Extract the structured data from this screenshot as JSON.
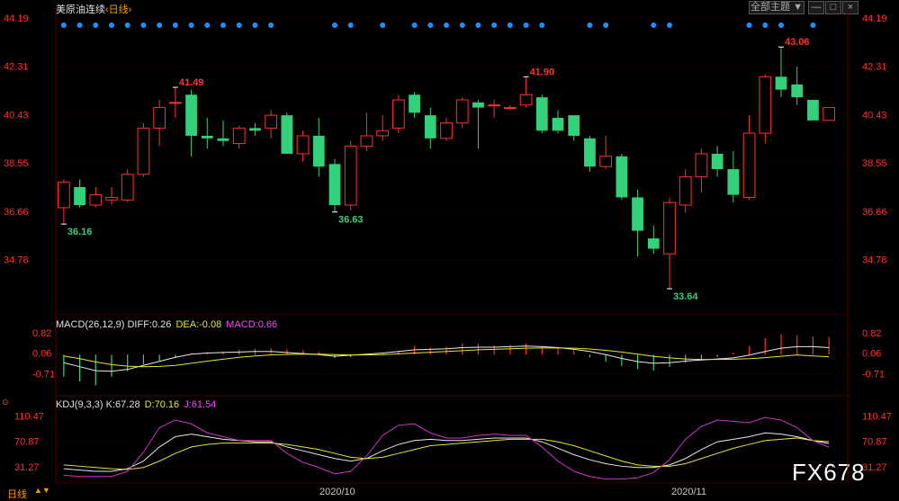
{
  "header": {
    "title": "美原油连续",
    "period": "‹日线›",
    "theme_button": "全部主题 ▼"
  },
  "colors": {
    "up": "#ff3030",
    "down": "#33d17a",
    "macd_diff": "#e8e8e8",
    "macd_dea": "#e6e62a",
    "macd_label": "#ff40ff",
    "kdj_k": "#e8e8e8",
    "kdj_d": "#e6e62a",
    "kdj_j": "#cc33cc",
    "axis_price": "#ff3030",
    "event_dot": "#1e90ff"
  },
  "icons": [
    "minimize-icon",
    "restore-icon",
    "close-icon"
  ],
  "macd_header": {
    "name": "MACD(26,12,9)",
    "diff": "DIFF:0.26",
    "dea": "DEA:-0.08",
    "macd": "MACD:0.66"
  },
  "kdj_header": {
    "name": "KDJ(9,3,3)",
    "k": "K:67.28",
    "d": "D:70.16",
    "j": "J:61.54"
  },
  "footer": {
    "period": "日线",
    "dates": [
      "2020/10",
      "2020/11"
    ]
  },
  "watermark": "FX678",
  "chart_data": [
    {
      "type": "candlestick",
      "title": "美原油连续 日线",
      "yticks": [
        "44.19",
        "42.31",
        "40.43",
        "38.55",
        "36.66",
        "34.78"
      ],
      "ylim": [
        32.8,
        44.19
      ],
      "extremes": [
        "36.16",
        "41.49",
        "36.63",
        "41.90",
        "33.64",
        "43.06"
      ],
      "candles": [
        {
          "o": 36.8,
          "h": 37.9,
          "l": 36.16,
          "c": 37.8
        },
        {
          "o": 37.6,
          "h": 37.9,
          "l": 36.8,
          "c": 36.9
        },
        {
          "o": 36.9,
          "h": 37.6,
          "l": 36.8,
          "c": 37.3
        },
        {
          "o": 37.1,
          "h": 37.6,
          "l": 36.9,
          "c": 37.2
        },
        {
          "o": 37.1,
          "h": 38.3,
          "l": 37.0,
          "c": 38.1
        },
        {
          "o": 38.1,
          "h": 40.1,
          "l": 38.0,
          "c": 39.9
        },
        {
          "o": 39.9,
          "h": 41.0,
          "l": 39.2,
          "c": 40.7
        },
        {
          "o": 40.9,
          "h": 41.49,
          "l": 40.3,
          "c": 40.9
        },
        {
          "o": 41.2,
          "h": 41.4,
          "l": 38.8,
          "c": 39.6
        },
        {
          "o": 39.6,
          "h": 40.3,
          "l": 39.1,
          "c": 39.5
        },
        {
          "o": 39.5,
          "h": 40.2,
          "l": 39.2,
          "c": 39.4
        },
        {
          "o": 39.3,
          "h": 40.0,
          "l": 39.1,
          "c": 39.9
        },
        {
          "o": 39.9,
          "h": 40.1,
          "l": 39.6,
          "c": 39.8
        },
        {
          "o": 39.9,
          "h": 40.6,
          "l": 39.5,
          "c": 40.4
        },
        {
          "o": 40.4,
          "h": 40.5,
          "l": 38.9,
          "c": 38.9
        },
        {
          "o": 38.9,
          "h": 39.8,
          "l": 38.6,
          "c": 39.6
        },
        {
          "o": 39.6,
          "h": 40.3,
          "l": 38.0,
          "c": 38.4
        },
        {
          "o": 38.5,
          "h": 38.7,
          "l": 36.63,
          "c": 36.9
        },
        {
          "o": 36.9,
          "h": 39.4,
          "l": 36.7,
          "c": 39.2
        },
        {
          "o": 39.2,
          "h": 40.5,
          "l": 39.0,
          "c": 39.6
        },
        {
          "o": 39.6,
          "h": 40.4,
          "l": 39.4,
          "c": 39.8
        },
        {
          "o": 39.9,
          "h": 41.2,
          "l": 39.7,
          "c": 41.0
        },
        {
          "o": 41.2,
          "h": 41.3,
          "l": 40.3,
          "c": 40.5
        },
        {
          "o": 40.4,
          "h": 40.7,
          "l": 39.1,
          "c": 39.5
        },
        {
          "o": 39.5,
          "h": 40.3,
          "l": 39.4,
          "c": 40.1
        },
        {
          "o": 40.1,
          "h": 41.1,
          "l": 39.9,
          "c": 41.0
        },
        {
          "o": 40.9,
          "h": 41.0,
          "l": 39.1,
          "c": 40.7
        },
        {
          "o": 40.8,
          "h": 41.0,
          "l": 40.3,
          "c": 40.8
        },
        {
          "o": 40.7,
          "h": 40.8,
          "l": 40.6,
          "c": 40.7
        },
        {
          "o": 40.8,
          "h": 41.9,
          "l": 40.7,
          "c": 41.2
        },
        {
          "o": 41.1,
          "h": 41.2,
          "l": 39.7,
          "c": 39.8
        },
        {
          "o": 40.3,
          "h": 40.6,
          "l": 39.7,
          "c": 39.8
        },
        {
          "o": 40.4,
          "h": 40.4,
          "l": 39.4,
          "c": 39.6
        },
        {
          "o": 39.5,
          "h": 39.6,
          "l": 38.2,
          "c": 38.4
        },
        {
          "o": 38.4,
          "h": 39.6,
          "l": 38.3,
          "c": 38.8
        },
        {
          "o": 38.8,
          "h": 38.9,
          "l": 37.1,
          "c": 37.2
        },
        {
          "o": 37.2,
          "h": 37.5,
          "l": 34.9,
          "c": 35.9
        },
        {
          "o": 35.6,
          "h": 36.1,
          "l": 35.0,
          "c": 35.2
        },
        {
          "o": 35.0,
          "h": 37.2,
          "l": 33.64,
          "c": 37.0
        },
        {
          "o": 36.9,
          "h": 38.3,
          "l": 36.6,
          "c": 38.0
        },
        {
          "o": 38.0,
          "h": 39.1,
          "l": 37.4,
          "c": 38.9
        },
        {
          "o": 38.9,
          "h": 39.2,
          "l": 38.0,
          "c": 38.3
        },
        {
          "o": 38.3,
          "h": 39.0,
          "l": 37.0,
          "c": 37.3
        },
        {
          "o": 37.2,
          "h": 40.4,
          "l": 37.1,
          "c": 39.7
        },
        {
          "o": 39.7,
          "h": 42.0,
          "l": 39.3,
          "c": 41.9
        },
        {
          "o": 41.9,
          "h": 43.06,
          "l": 41.1,
          "c": 41.4
        },
        {
          "o": 41.6,
          "h": 42.3,
          "l": 40.8,
          "c": 41.1
        },
        {
          "o": 41.0,
          "h": 41.0,
          "l": 40.2,
          "c": 40.2
        },
        {
          "o": 40.2,
          "h": 40.7,
          "l": 40.2,
          "c": 40.7
        }
      ],
      "event_dots": [
        1,
        1,
        1,
        1,
        1,
        1,
        1,
        1,
        1,
        1,
        1,
        1,
        1,
        1,
        0,
        0,
        0,
        1,
        1,
        0,
        1,
        0,
        1,
        1,
        1,
        1,
        1,
        1,
        1,
        1,
        1,
        0,
        0,
        1,
        1,
        0,
        0,
        1,
        1,
        0,
        0,
        0,
        0,
        1,
        1,
        1,
        0,
        1,
        0
      ]
    },
    {
      "type": "line",
      "title": "MACD(26,12,9)",
      "yticks": [
        "0.82",
        "0.06",
        "-0.71"
      ],
      "ylim": [
        -1.4,
        0.95
      ],
      "histogram": [
        -0.82,
        -1.0,
        -1.15,
        -0.82,
        -0.62,
        -0.36,
        -0.24,
        -0.1,
        0.05,
        0.1,
        0.12,
        0.18,
        0.22,
        0.24,
        0.2,
        0.16,
        0.1,
        -0.12,
        -0.1,
        0.0,
        0.06,
        0.14,
        0.32,
        0.26,
        0.3,
        0.42,
        0.4,
        0.34,
        0.36,
        0.42,
        0.3,
        0.24,
        0.16,
        -0.1,
        -0.26,
        -0.42,
        -0.54,
        -0.6,
        -0.46,
        -0.3,
        -0.2,
        -0.08,
        0.08,
        0.32,
        0.62,
        0.76,
        0.72,
        0.68,
        0.66
      ],
      "series": [
        {
          "name": "DIFF",
          "values": [
            -0.3,
            -0.45,
            -0.6,
            -0.62,
            -0.55,
            -0.4,
            -0.25,
            -0.1,
            0.02,
            0.06,
            0.08,
            0.1,
            0.12,
            0.12,
            0.08,
            0.04,
            0.0,
            -0.06,
            -0.02,
            0.02,
            0.06,
            0.12,
            0.18,
            0.2,
            0.22,
            0.26,
            0.28,
            0.28,
            0.3,
            0.32,
            0.3,
            0.26,
            0.2,
            0.12,
            0.0,
            -0.14,
            -0.26,
            -0.32,
            -0.3,
            -0.24,
            -0.2,
            -0.16,
            -0.12,
            -0.02,
            0.12,
            0.24,
            0.3,
            0.3,
            0.26
          ]
        },
        {
          "name": "DEA",
          "values": [
            -0.05,
            -0.15,
            -0.27,
            -0.37,
            -0.43,
            -0.45,
            -0.44,
            -0.4,
            -0.32,
            -0.24,
            -0.17,
            -0.1,
            -0.05,
            -0.01,
            0.01,
            0.02,
            0.02,
            0.0,
            -0.01,
            -0.01,
            0.0,
            0.03,
            0.06,
            0.09,
            0.12,
            0.15,
            0.18,
            0.2,
            0.22,
            0.24,
            0.25,
            0.25,
            0.24,
            0.21,
            0.16,
            0.1,
            0.02,
            -0.06,
            -0.12,
            -0.16,
            -0.18,
            -0.18,
            -0.17,
            -0.15,
            -0.11,
            -0.06,
            -0.01,
            -0.05,
            -0.08
          ]
        }
      ]
    },
    {
      "type": "line",
      "title": "KDJ(9,3,3)",
      "yticks": [
        "110.47",
        "70.87",
        "31.27"
      ],
      "ylim": [
        10,
        125
      ],
      "series": [
        {
          "name": "K",
          "values": [
            28,
            26,
            24,
            24,
            28,
            40,
            62,
            78,
            82,
            78,
            74,
            72,
            70,
            70,
            62,
            56,
            50,
            44,
            40,
            44,
            56,
            66,
            72,
            74,
            72,
            72,
            74,
            76,
            76,
            76,
            70,
            60,
            50,
            42,
            36,
            32,
            30,
            30,
            34,
            44,
            58,
            70,
            74,
            78,
            84,
            82,
            78,
            72,
            67.28
          ]
        },
        {
          "name": "D",
          "values": [
            34,
            32,
            30,
            28,
            27,
            30,
            40,
            52,
            62,
            66,
            68,
            68,
            68,
            68,
            66,
            62,
            58,
            52,
            46,
            44,
            46,
            52,
            58,
            64,
            66,
            68,
            70,
            72,
            74,
            74,
            74,
            70,
            64,
            56,
            48,
            40,
            34,
            32,
            32,
            36,
            44,
            52,
            60,
            66,
            72,
            74,
            76,
            72,
            70.16
          ]
        },
        {
          "name": "J",
          "values": [
            18,
            16,
            16,
            16,
            24,
            54,
            92,
            104,
            98,
            84,
            78,
            72,
            72,
            72,
            52,
            38,
            30,
            20,
            24,
            48,
            80,
            96,
            98,
            84,
            76,
            76,
            80,
            82,
            80,
            80,
            62,
            40,
            24,
            16,
            12,
            12,
            14,
            22,
            42,
            74,
            94,
            104,
            102,
            100,
            108,
            104,
            92,
            72,
            61.54
          ]
        }
      ]
    }
  ]
}
